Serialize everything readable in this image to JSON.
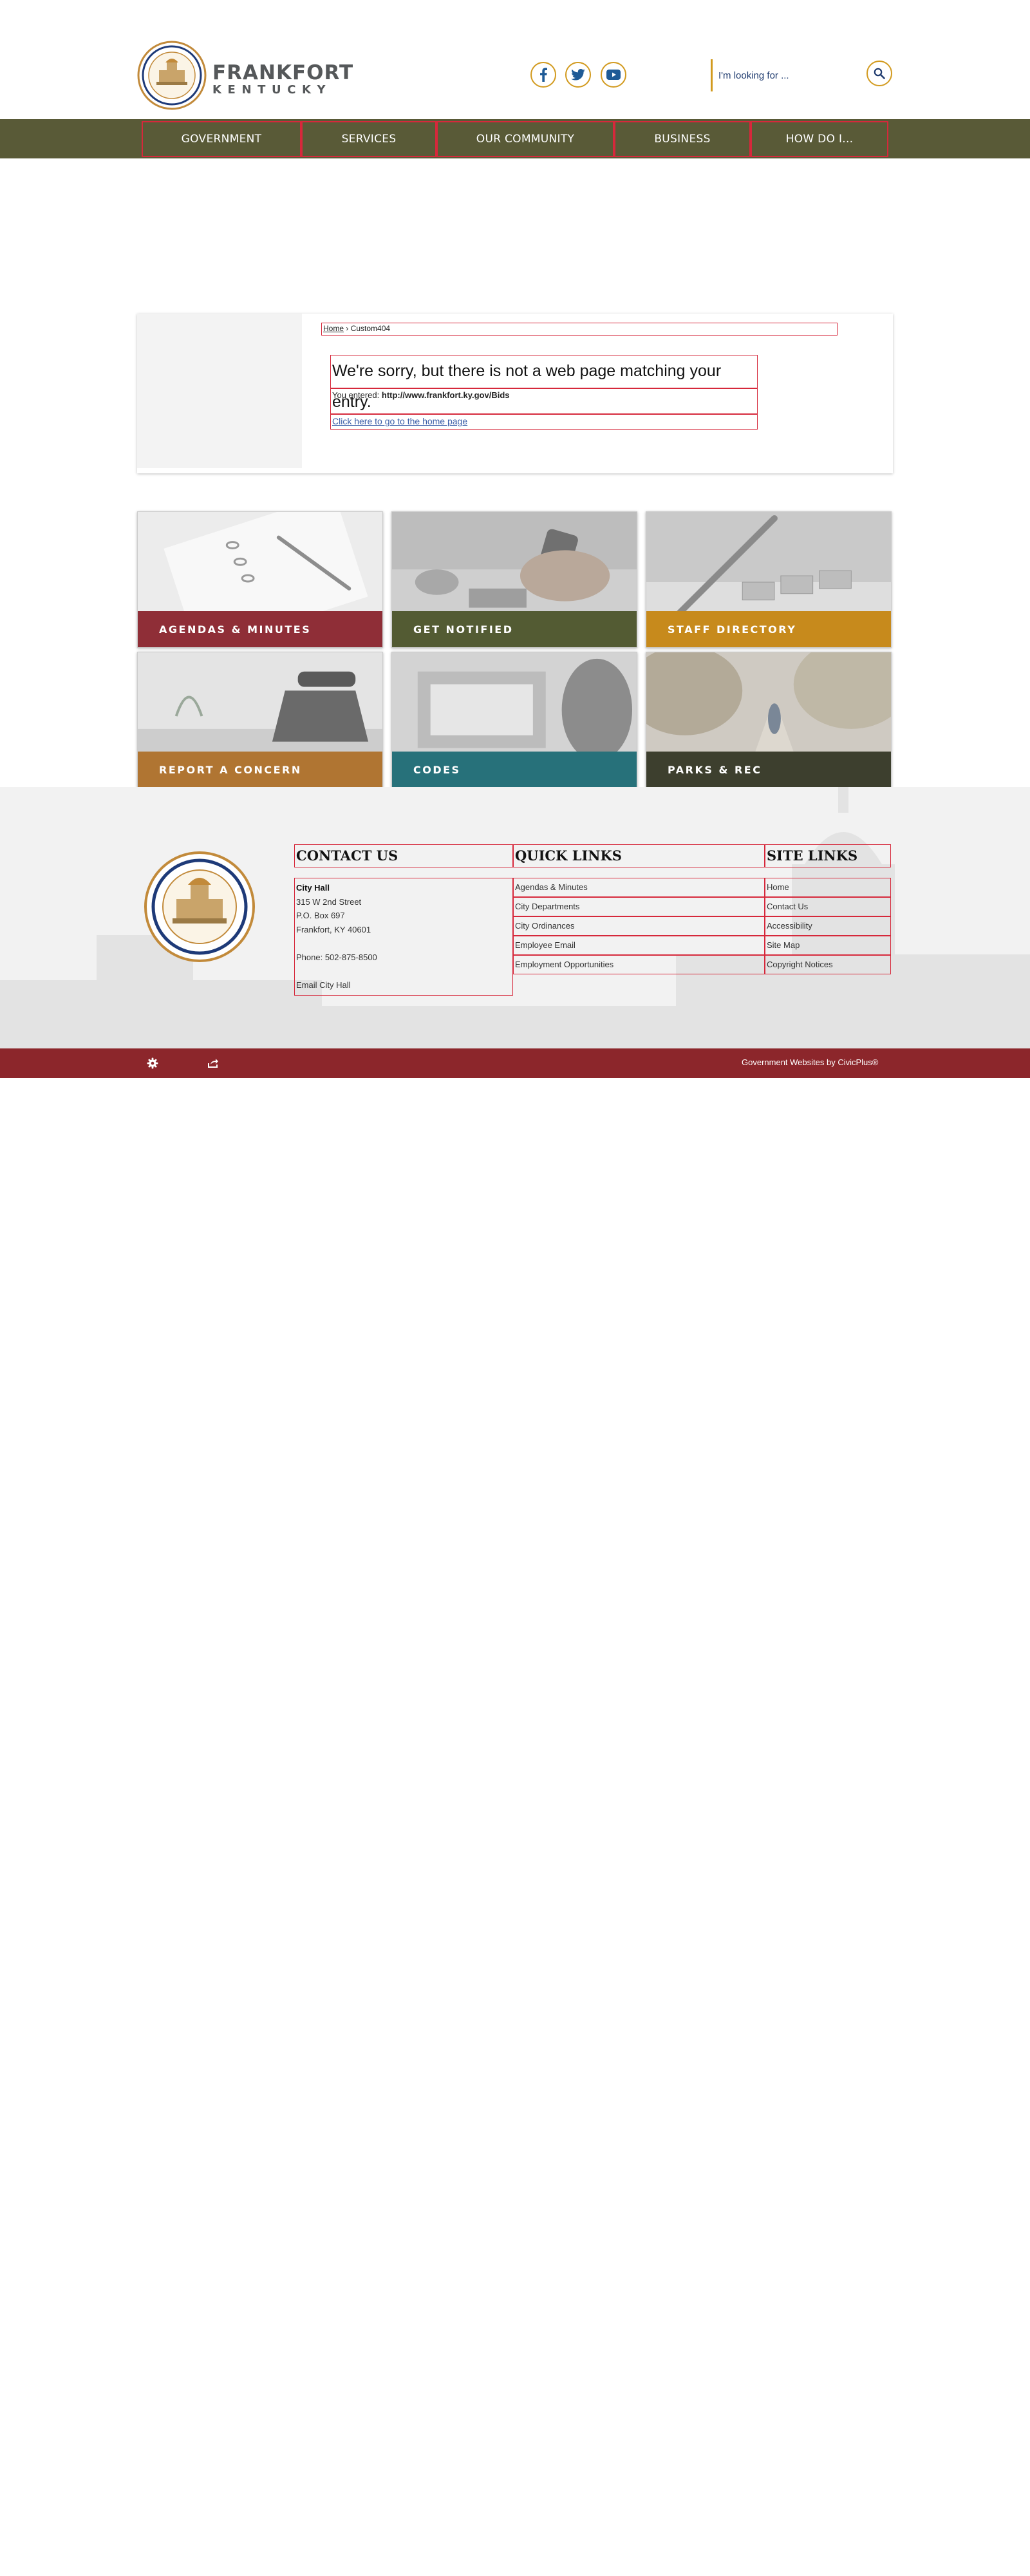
{
  "header": {
    "city_name": "FRANKFORT",
    "state_name": "KENTUCKY",
    "search_placeholder": "I'm looking for ..."
  },
  "social": {
    "facebook_icon": "facebook-icon",
    "twitter_icon": "twitter-icon",
    "youtube_icon": "youtube-icon"
  },
  "nav": {
    "items": [
      {
        "label": "GOVERNMENT"
      },
      {
        "label": "SERVICES"
      },
      {
        "label": "OUR COMMUNITY"
      },
      {
        "label": "BUSINESS"
      },
      {
        "label": "HOW DO I..."
      }
    ]
  },
  "breadcrumb": {
    "home": "Home",
    "separator": " › ",
    "current": "Custom404"
  },
  "error": {
    "heading": "We're sorry, but there is not a web page matching your entry.",
    "entered_label": "You entered: ",
    "entered_url": "http://www.frankfort.ky.gov/Bids",
    "home_link": "Click here to go to the home page"
  },
  "tiles": [
    {
      "label": "AGENDAS & MINUTES",
      "color": "#8f2e37"
    },
    {
      "label": "GET NOTIFIED",
      "color": "#535b33"
    },
    {
      "label": "STAFF DIRECTORY",
      "color": "#c78a1c"
    },
    {
      "label": "REPORT A CONCERN",
      "color": "#b07532"
    },
    {
      "label": "CODES",
      "color": "#27717a"
    },
    {
      "label": "PARKS & REC",
      "color": "#3d3f2e"
    }
  ],
  "footer": {
    "contact_title": "CONTACT US",
    "quicklinks_title": "QUICK LINKS",
    "sitelinks_title": "SITE LINKS",
    "contact": {
      "name": "City Hall",
      "street": "315 W 2nd Street",
      "po_box": "P.O. Box 697",
      "city": "Frankfort, KY 40601",
      "phone": "Phone: 502-875-8500",
      "email": "Email City Hall"
    },
    "quick_links": [
      "Agendas & Minutes",
      "City Departments",
      "City Ordinances",
      "Employee Email",
      "Employment Opportunities"
    ],
    "site_links": [
      "Home",
      "Contact Us",
      "Accessibility",
      "Site Map",
      "Copyright Notices"
    ]
  },
  "bottom_bar": {
    "credit": "Government Websites by CivicPlus®",
    "color": "#8c262b"
  },
  "colors": {
    "nav_bg": "#595a37",
    "accent_gold": "#d29a1e",
    "link_blue": "#3a5ea8"
  }
}
